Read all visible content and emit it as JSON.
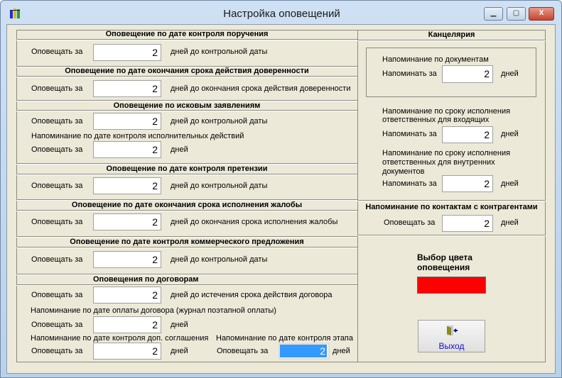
{
  "window": {
    "title": "Настройка оповещений",
    "minimize": "▁",
    "maximize": "▢",
    "close": "X"
  },
  "left": {
    "s1": {
      "title": "Оповещение по дате контроля поручения",
      "label": "Оповещать за",
      "value": "2",
      "suffix": "дней до контрольной даты"
    },
    "s2": {
      "title": "Оповещение по дате окончания срока действия доверенности",
      "label": "Оповещать за",
      "value": "2",
      "suffix": "дней до окончания срока действия доверенности"
    },
    "s3": {
      "title": "Оповещение по исковым заявлениям",
      "label": "Оповещать за",
      "value": "2",
      "suffix": "дней до контрольной даты",
      "sub": "Напоминание по дате контроля исполнительных действий",
      "label2": "Оповещать за",
      "value2": "2",
      "suffix2": "дней"
    },
    "s4": {
      "title": "Оповещение по дате контроля претензии",
      "label": "Оповещать за",
      "value": "2",
      "suffix": "дней до контрольной даты"
    },
    "s5": {
      "title": "Оповещение по дате окончания срока исполнения жалобы",
      "label": "Оповещать за",
      "value": "2",
      "suffix": "дней до окончания срока исполнения жалобы"
    },
    "s6": {
      "title": "Оповещение по дате контроля коммерческого предложения",
      "label": "Оповещать за",
      "value": "2",
      "suffix": "дней до контрольной даты"
    },
    "s7": {
      "title": "Оповещения по договорам",
      "label": "Оповещать за",
      "value": "2",
      "suffix": "дней до истечения срока действия договора",
      "sub1": "Напоминание по дате оплаты договора (журнал поэтапной оплаты)",
      "label2": "Оповещать за",
      "value2": "2",
      "suffix2": "дней",
      "sub2": "Напоминание по дате контроля доп. соглашения",
      "label3": "Оповещать за",
      "value3": "2",
      "suffix3": "дней",
      "sub3": "Напоминание по дате контроля этапа",
      "label4": "Оповещать за",
      "value4": "2",
      "suffix4": "дней"
    }
  },
  "right": {
    "title": "Канцелярия",
    "docs": {
      "title": "Напоминание по документам",
      "label": "Напоминать за",
      "value": "2",
      "suffix": "дней"
    },
    "incoming": {
      "line1": "Напоминание по сроку исполнения",
      "line2": "ответственных для входящих",
      "label": "Напоминать за",
      "value": "2",
      "suffix": "дней"
    },
    "internal": {
      "line1": "Напоминание по сроку исполнения",
      "line2": "ответственных для внутренних",
      "line3": "документов",
      "label": "Напоминать за",
      "value": "2",
      "suffix": "дней"
    },
    "contacts": {
      "title": "Напоминание по контактам с контрагентами",
      "label": "Оповещать за",
      "value": "2",
      "suffix": "дней"
    },
    "color": {
      "line1": "Выбор цвета",
      "line2": "оповещения",
      "value": "#ff0000"
    },
    "exit": "Выход"
  }
}
